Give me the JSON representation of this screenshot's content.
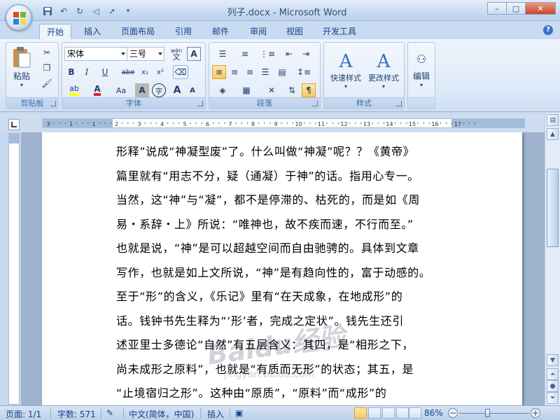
{
  "window": {
    "title": "列子.docx - Microsoft Word",
    "controls": {
      "minimize": "–",
      "maximize": "□",
      "close": "✕"
    }
  },
  "quick_access": [
    "save-icon",
    "undo-icon",
    "redo-icon",
    "format-painter-icon",
    "cursor-icon",
    "customize-icon"
  ],
  "tabs": [
    {
      "label": "开始",
      "active": true
    },
    {
      "label": "插入"
    },
    {
      "label": "页面布局"
    },
    {
      "label": "引用"
    },
    {
      "label": "邮件"
    },
    {
      "label": "审阅"
    },
    {
      "label": "视图"
    },
    {
      "label": "开发工具"
    }
  ],
  "ribbon": {
    "clipboard": {
      "label": "剪贴板",
      "paste": "粘贴"
    },
    "font": {
      "label": "字体",
      "font_name": "宋体",
      "font_size": "三号",
      "pinyin": "wén",
      "bold": "B",
      "italic": "I",
      "underline": "U",
      "strike": "abe",
      "subscript": "x₂",
      "superscript": "x²",
      "case": "Aa",
      "shade": "A",
      "enclose": "字",
      "grow": "A",
      "shrink": "A"
    },
    "paragraph": {
      "label": "段落"
    },
    "styles": {
      "label": "样式",
      "quick_styles": "快速样式",
      "change_styles": "更改样式"
    },
    "editing": {
      "label": "编辑"
    }
  },
  "document": {
    "lines": [
      "形释”说成“神凝型废”了。什么叫做“神凝”呢？？《黄帝》",
      "篇里就有“用志不分，疑（通凝）于神”的话。指用心专一。",
      "当然，这“神”与“凝”，都不是停滞的、枯死的，而是如《周",
      "易・系辞・上》所说：“唯神也，故不疾而速，不行而至。”",
      "也就是说，“神”是可以超越空间而自由驰骋的。具体到文章",
      "写作，也就是如上文所说，“神”是有趋向性的，富于动感的。",
      "至于“形”的含义，《乐记》里有“在天成象，在地成形”的",
      "话。钱钟书先生释为“‘形’者，完成之定状”。钱先生还引",
      "述亚里士多德论“自然”有五层含义：其四，是“相形之下，",
      "尚未成形之原料”，也就是“有质而无形”的状态；其五，是",
      "“止境宿归之形”。这种由“原质”，“原料”而“成形”的"
    ],
    "watermark": "Baidu经验",
    "watermark_url": "jingyan.baidu.com"
  },
  "ruler": {
    "ticks": [
      "3",
      "1",
      "1",
      "2",
      "3",
      "4",
      "5",
      "6",
      "7",
      "8",
      "9",
      "10",
      "11",
      "12",
      "13",
      "14",
      "15",
      "16",
      "17"
    ]
  },
  "status": {
    "page": "页面: 1/1",
    "words": "字数: 571",
    "language": "中文(简体，中国)",
    "mode": "插入",
    "zoom": "86%",
    "zoom_minus": "−",
    "zoom_plus": "+"
  }
}
